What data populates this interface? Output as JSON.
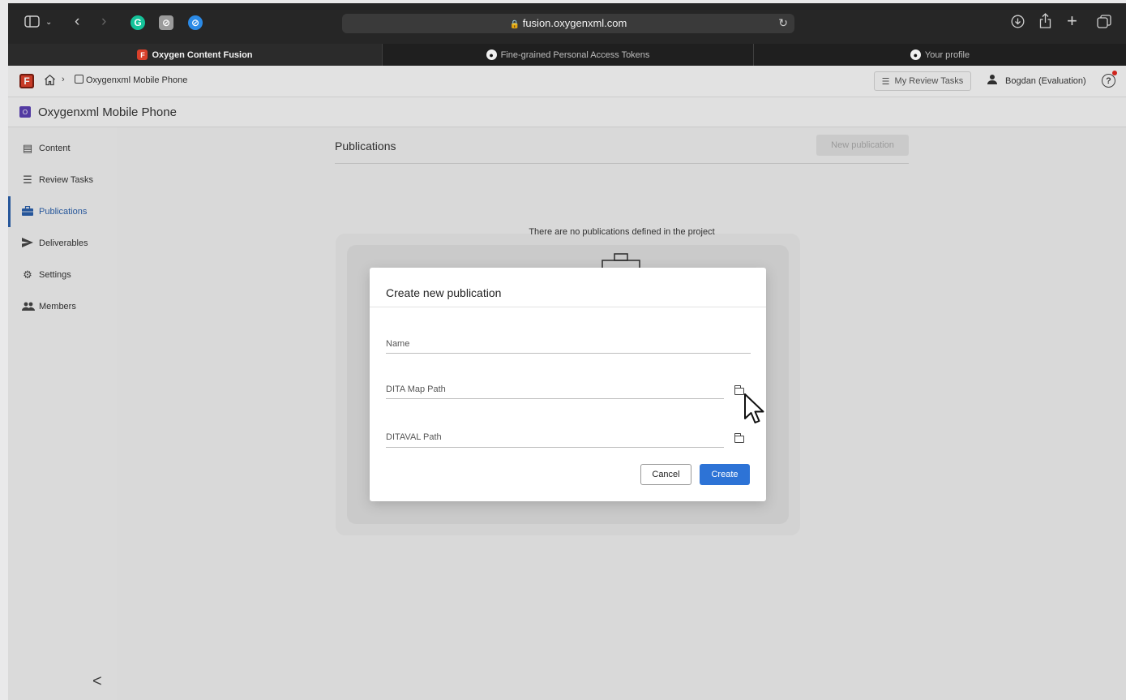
{
  "browser": {
    "url": "fusion.oxygenxml.com",
    "tabs": [
      {
        "label": "Oxygen Content Fusion",
        "active": true
      },
      {
        "label": "Fine-grained Personal Access Tokens",
        "active": false
      },
      {
        "label": "Your profile",
        "active": false
      }
    ]
  },
  "app": {
    "logo": "F",
    "breadcrumb_project": "Oxygenxml Mobile Phone",
    "my_review_tasks": "My Review Tasks",
    "user": "Bogdan",
    "user_status": "(Evaluation)",
    "help": "?"
  },
  "project": {
    "badge": "O",
    "title": "Oxygenxml Mobile Phone"
  },
  "sidebar": {
    "items": [
      {
        "label": "Content",
        "icon": "archive-icon"
      },
      {
        "label": "Review Tasks",
        "icon": "checklist-icon"
      },
      {
        "label": "Publications",
        "icon": "briefcase-icon"
      },
      {
        "label": "Deliverables",
        "icon": "send-icon"
      },
      {
        "label": "Settings",
        "icon": "gear-icon"
      },
      {
        "label": "Members",
        "icon": "people-icon"
      }
    ],
    "collapse": "<"
  },
  "main": {
    "section_title": "Publications",
    "new_button": "New publication",
    "empty_message": "There are no publications defined in the project"
  },
  "dialog": {
    "title": "Create new publication",
    "name_label": "Name",
    "ditamap_label": "DITA Map Path",
    "ditaval_label": "DITAVAL Path",
    "cancel": "Cancel",
    "create": "Create"
  },
  "colors": {
    "accent": "#2d73d6",
    "active_nav": "#2a5ea8",
    "chrome_dark": "#262626"
  }
}
